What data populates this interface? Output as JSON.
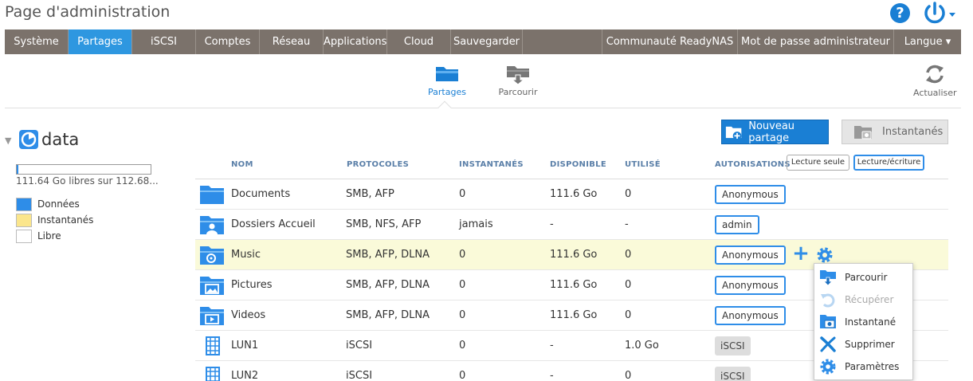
{
  "app": {
    "title": "Page d'administration"
  },
  "header": {
    "help_label": "?"
  },
  "topnav": {
    "items": [
      {
        "label": "Système",
        "active": false,
        "width": 80
      },
      {
        "label": "Partages",
        "active": true,
        "width": 80
      },
      {
        "label": "iSCSI",
        "active": false,
        "width": 80
      },
      {
        "label": "Comptes",
        "active": false,
        "width": 80
      },
      {
        "label": "Réseau",
        "active": false,
        "width": 80
      },
      {
        "label": "Applications",
        "active": false,
        "width": 80
      },
      {
        "label": "Cloud",
        "active": false,
        "width": 80
      },
      {
        "label": "Sauvegarder",
        "active": false,
        "width": 90
      }
    ],
    "right_items": [
      {
        "label": "Communauté ReadyNAS"
      },
      {
        "label": "Mot de passe administrateur"
      },
      {
        "label": "Langue ▾"
      }
    ]
  },
  "subnav": {
    "items": [
      {
        "label": "Partages",
        "icon": "folder-icon",
        "active": true
      },
      {
        "label": "Parcourir",
        "icon": "browse-icon",
        "active": false
      }
    ],
    "refresh_label": "Actualiser"
  },
  "volume": {
    "name": "data",
    "free_text": "111.64 Go libres sur 112.68...",
    "used_fraction": 0.01,
    "legend": [
      {
        "label": "Données",
        "color": "#2e8de8"
      },
      {
        "label": "Instantanés",
        "color": "#fbe68c"
      },
      {
        "label": "Libre",
        "color": "#ffffff"
      }
    ]
  },
  "actions": {
    "new_share": "Nouveau partage",
    "snapshots": "Instantanés"
  },
  "table": {
    "headers": {
      "name": "NOM",
      "protocols": "PROTOCOLES",
      "snapshots": "INSTANTANÉS",
      "available": "DISPONIBLE",
      "used": "UTILISÉ",
      "permissions": "AUTORISATIONS"
    },
    "perm_readonly": "Lecture seule",
    "perm_readwrite": "Lecture/écriture",
    "rows": [
      {
        "name": "Documents",
        "protocols": "SMB, AFP",
        "snapshots": "0",
        "available": "111.6 Go",
        "used": "0",
        "permission": "Anonymous",
        "kind": "share",
        "icon": "folder-icon"
      },
      {
        "name": "Dossiers Accueil",
        "protocols": "SMB, NFS, AFP",
        "snapshots": "jamais",
        "available": "-",
        "used": "-",
        "permission": "admin",
        "kind": "share",
        "icon": "home-folder-icon"
      },
      {
        "name": "Music",
        "protocols": "SMB, AFP, DLNA",
        "snapshots": "0",
        "available": "111.6 Go",
        "used": "0",
        "permission": "Anonymous",
        "kind": "share",
        "icon": "music-folder-icon"
      },
      {
        "name": "Pictures",
        "protocols": "SMB, AFP, DLNA",
        "snapshots": "0",
        "available": "111.6 Go",
        "used": "0",
        "permission": "Anonymous",
        "kind": "share",
        "icon": "pictures-folder-icon"
      },
      {
        "name": "Videos",
        "protocols": "SMB, AFP, DLNA",
        "snapshots": "0",
        "available": "111.6 Go",
        "used": "0",
        "permission": "Anonymous",
        "kind": "share",
        "icon": "videos-folder-icon"
      },
      {
        "name": "LUN1",
        "protocols": "iSCSI",
        "snapshots": "0",
        "available": "-",
        "used": "1.0 Go",
        "permission": "iSCSI",
        "kind": "lun",
        "icon": "lun-icon"
      },
      {
        "name": "LUN2",
        "protocols": "iSCSI",
        "snapshots": "0",
        "available": "-",
        "used": "0",
        "permission": "iSCSI",
        "kind": "lun",
        "icon": "lun-icon"
      }
    ],
    "highlighted_row": 2
  },
  "context_menu": {
    "items": [
      {
        "label": "Parcourir",
        "icon": "browse-icon",
        "disabled": false
      },
      {
        "label": "Récupérer",
        "icon": "restore-icon",
        "disabled": true
      },
      {
        "label": "Instantané",
        "icon": "snapshot-icon",
        "disabled": false
      },
      {
        "label": "Supprimer",
        "icon": "delete-icon",
        "disabled": false
      },
      {
        "label": "Paramètres",
        "icon": "settings-icon",
        "disabled": false
      }
    ]
  },
  "colors": {
    "accent": "#1a7fd4",
    "nav_bg": "#7b726b",
    "nav_active": "#2e97e0",
    "highlight_row": "#fafad9"
  }
}
